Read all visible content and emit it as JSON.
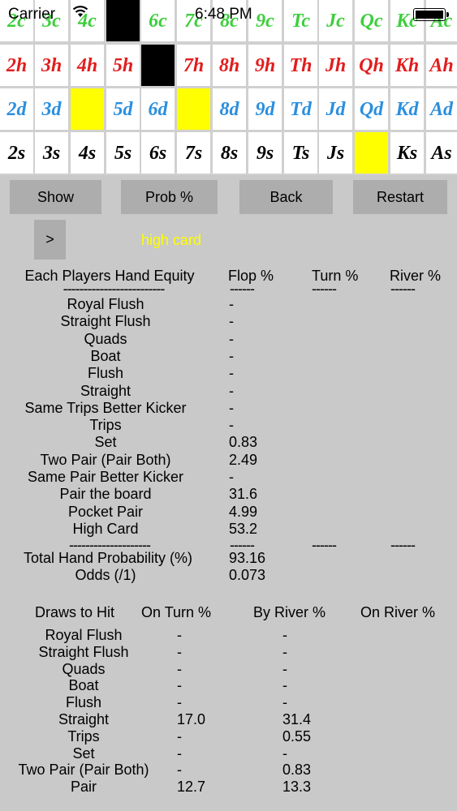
{
  "status_bar": {
    "carrier": "Carrier",
    "time": "6:48 PM"
  },
  "card_rows": [
    {
      "suit": "clubs",
      "cards": [
        "2c",
        "3c",
        "4c",
        "",
        "6c",
        "7c",
        "8c",
        "9c",
        "Tc",
        "Jc",
        "Qc",
        "Kc",
        "Ac"
      ],
      "states": [
        "",
        "",
        "",
        "black",
        "",
        "",
        "",
        "",
        "",
        "",
        "",
        "",
        ""
      ]
    },
    {
      "suit": "hearts",
      "cards": [
        "2h",
        "3h",
        "4h",
        "5h",
        "",
        "7h",
        "8h",
        "9h",
        "Th",
        "Jh",
        "Qh",
        "Kh",
        "Ah"
      ],
      "states": [
        "",
        "",
        "",
        "",
        "black",
        "",
        "",
        "",
        "",
        "",
        "",
        "",
        ""
      ]
    },
    {
      "suit": "diamonds",
      "cards": [
        "2d",
        "3d",
        "",
        "5d",
        "6d",
        "",
        "8d",
        "9d",
        "Td",
        "Jd",
        "Qd",
        "Kd",
        "Ad"
      ],
      "states": [
        "",
        "",
        "yellow",
        "",
        "",
        "yellow",
        "",
        "",
        "",
        "",
        "",
        "",
        ""
      ]
    },
    {
      "suit": "spades",
      "cards": [
        "2s",
        "3s",
        "4s",
        "5s",
        "6s",
        "7s",
        "8s",
        "9s",
        "Ts",
        "Js",
        "",
        "Ks",
        "As"
      ],
      "states": [
        "",
        "",
        "",
        "",
        "",
        "",
        "",
        "",
        "",
        "",
        "yellow",
        "",
        ""
      ]
    }
  ],
  "buttons": {
    "show": "Show",
    "prob": "Prob %",
    "back": "Back",
    "restart": "Restart",
    "next": ">"
  },
  "hand_label": "high card",
  "equity": {
    "header": {
      "label": "Each Players Hand Equity",
      "flop": "Flop %",
      "turn": "Turn %",
      "river": "River %"
    },
    "dash_label": "-------------------------",
    "dash_col": "------",
    "rows": [
      {
        "label": "Royal Flush",
        "flop": "-"
      },
      {
        "label": "Straight Flush",
        "flop": "-"
      },
      {
        "label": "Quads",
        "flop": "-"
      },
      {
        "label": "Boat",
        "flop": "-"
      },
      {
        "label": "Flush",
        "flop": "-"
      },
      {
        "label": "Straight",
        "flop": "-"
      },
      {
        "label": "Same Trips Better Kicker",
        "flop": "-"
      },
      {
        "label": "Trips",
        "flop": "-"
      },
      {
        "label": "Set",
        "flop": "0.83"
      },
      {
        "label": "Two Pair (Pair Both)",
        "flop": "2.49"
      },
      {
        "label": "Same Pair Better Kicker",
        "flop": "-"
      },
      {
        "label": "Pair the board",
        "flop": "31.6"
      },
      {
        "label": "Pocket Pair",
        "flop": "4.99"
      },
      {
        "label": "High Card",
        "flop": "53.2"
      }
    ],
    "dash2_label": "--------------------",
    "dash2_col": "------",
    "total": {
      "label": "Total Hand Probability (%)",
      "flop": "93.16"
    },
    "odds": {
      "label": "Odds (/1)",
      "flop": "0.073"
    }
  },
  "draws": {
    "header": {
      "label": "Draws to Hit",
      "turn": "On Turn %",
      "by_river": "By River %",
      "on_river": "On River %"
    },
    "rows": [
      {
        "label": "Royal Flush",
        "turn": "-",
        "by_river": "-"
      },
      {
        "label": "Straight Flush",
        "turn": "-",
        "by_river": "-"
      },
      {
        "label": "Quads",
        "turn": "-",
        "by_river": "-"
      },
      {
        "label": "Boat",
        "turn": "-",
        "by_river": "-"
      },
      {
        "label": "Flush",
        "turn": "-",
        "by_river": "-"
      },
      {
        "label": "Straight",
        "turn": "17.0",
        "by_river": "31.4"
      },
      {
        "label": "Trips",
        "turn": "-",
        "by_river": "0.55"
      },
      {
        "label": "Set",
        "turn": "-",
        "by_river": "-"
      },
      {
        "label": "Two Pair (Pair Both)",
        "turn": "-",
        "by_river": "0.83"
      },
      {
        "label": "Pair",
        "turn": "12.7",
        "by_river": "13.3"
      }
    ]
  }
}
